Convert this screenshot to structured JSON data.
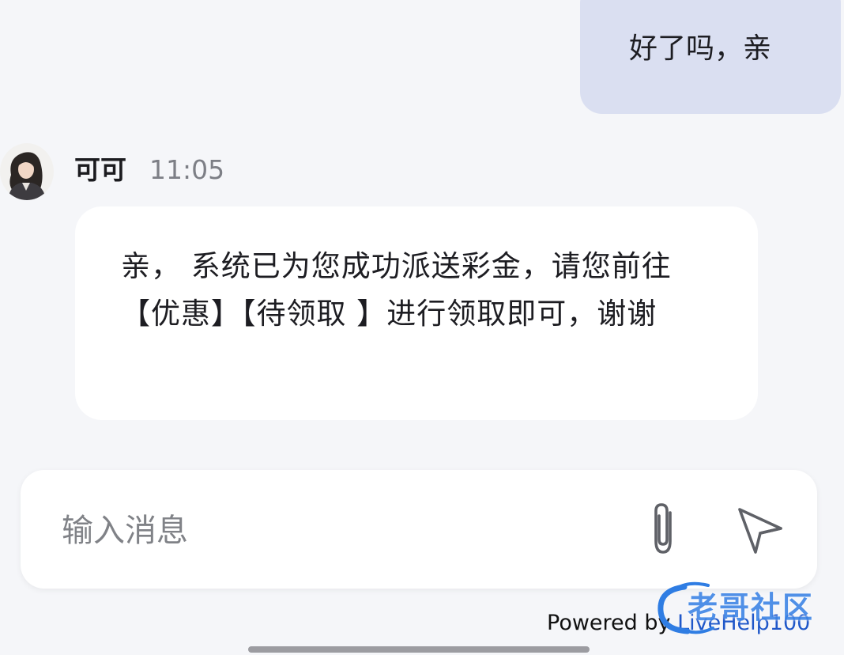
{
  "conversation": {
    "sent_message": {
      "text": "好了吗，亲"
    },
    "received_message": {
      "sender_name": "可可",
      "time": "11:05",
      "text": "亲， 系统已为您成功派送彩金，请您前往【优惠】【待领取 】进行领取即可，谢谢"
    }
  },
  "composer": {
    "placeholder": "输入消息",
    "value": "",
    "attach_icon": "paperclip-icon",
    "send_icon": "send-icon"
  },
  "footer": {
    "powered_prefix": "Powered by ",
    "powered_brand": "LiveHelp100"
  },
  "watermark": {
    "text": "老哥社区"
  },
  "colors": {
    "background": "#f5f6f9",
    "sent_bubble": "#dadff1",
    "received_bubble": "#ffffff",
    "timestamp": "#7d7f86",
    "brand_link": "#1f57c9",
    "watermark": "#3f86e6"
  }
}
